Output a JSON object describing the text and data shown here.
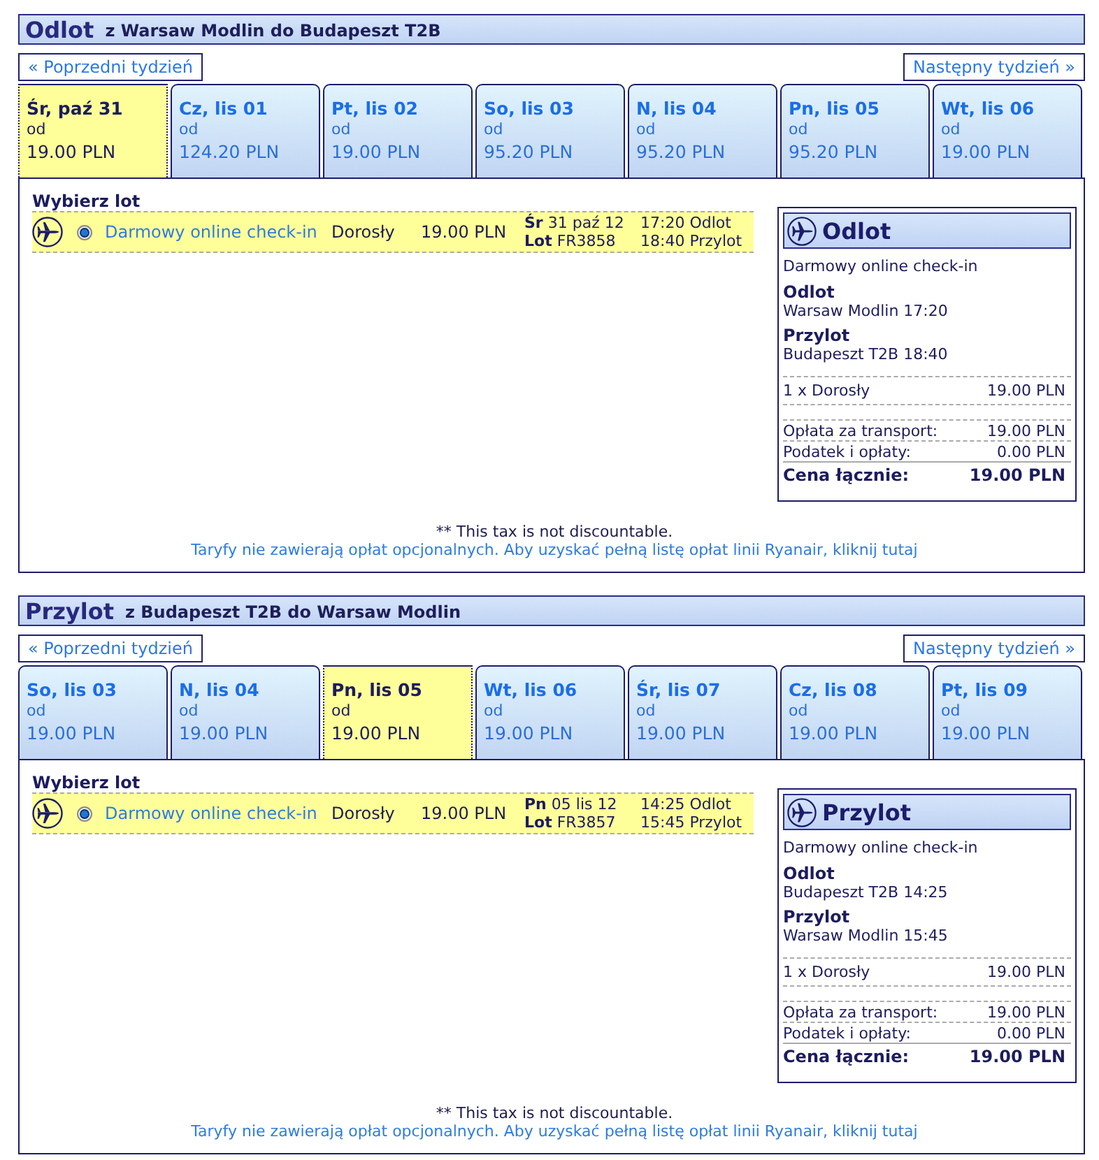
{
  "sections": [
    {
      "title": "Odlot",
      "route": "z Warsaw Modlin do Budapeszt T2B",
      "prev_week": "« Poprzedni tydzień",
      "next_week": "Następny tydzień »",
      "days": [
        {
          "label": "Śr, paź 31",
          "from_label": "od",
          "price": "19.00 PLN",
          "selected": true
        },
        {
          "label": "Cz, lis 01",
          "from_label": "od",
          "price": "124.20 PLN",
          "selected": false
        },
        {
          "label": "Pt, lis 02",
          "from_label": "od",
          "price": "19.00 PLN",
          "selected": false
        },
        {
          "label": "So, lis 03",
          "from_label": "od",
          "price": "95.20 PLN",
          "selected": false
        },
        {
          "label": "N, lis 04",
          "from_label": "od",
          "price": "95.20 PLN",
          "selected": false
        },
        {
          "label": "Pn, lis 05",
          "from_label": "od",
          "price": "95.20 PLN",
          "selected": false
        },
        {
          "label": "Wt, lis 06",
          "from_label": "od",
          "price": "19.00 PLN",
          "selected": false
        }
      ],
      "choose_label": "Wybierz lot",
      "flights": [
        {
          "selected": true,
          "fare": "Darmowy online check-in",
          "passenger": "Dorosły",
          "price": "19.00 PLN",
          "day": "Śr",
          "date": "31 paź 12",
          "flight_label": "Lot",
          "flight_no": "FR3858",
          "departure": "17:20 Odlot",
          "arrival": "18:40 Przylot"
        }
      ],
      "summary": {
        "title": "Odlot",
        "fare": "Darmowy online check-in",
        "stops": [
          {
            "label": "Odlot",
            "value": "Warsaw Modlin 17:20"
          },
          {
            "label": "Przylot",
            "value": "Budapeszt T2B 18:40"
          }
        ],
        "passengers": [
          {
            "label": "1 x Dorosły",
            "value": "19.00 PLN"
          }
        ],
        "fees": [
          {
            "label": "Opłata za transport:",
            "value": "19.00 PLN"
          },
          {
            "label": "Podatek i opłaty:",
            "value": "0.00 PLN"
          }
        ],
        "total": {
          "label": "Cena łącznie:",
          "value": "19.00 PLN"
        }
      },
      "tax_note": "** This tax is not discountable.",
      "fares_note": "Taryfy nie zawierają opłat opcjonalnych. Aby uzyskać pełną listę opłat linii Ryanair, kliknij tutaj"
    },
    {
      "title": "Przylot",
      "route": "z Budapeszt T2B do Warsaw Modlin",
      "prev_week": "« Poprzedni tydzień",
      "next_week": "Następny tydzień »",
      "days": [
        {
          "label": "So, lis 03",
          "from_label": "od",
          "price": "19.00 PLN",
          "selected": false
        },
        {
          "label": "N, lis 04",
          "from_label": "od",
          "price": "19.00 PLN",
          "selected": false
        },
        {
          "label": "Pn, lis 05",
          "from_label": "od",
          "price": "19.00 PLN",
          "selected": true
        },
        {
          "label": "Wt, lis 06",
          "from_label": "od",
          "price": "19.00 PLN",
          "selected": false
        },
        {
          "label": "Śr, lis 07",
          "from_label": "od",
          "price": "19.00 PLN",
          "selected": false
        },
        {
          "label": "Cz, lis 08",
          "from_label": "od",
          "price": "19.00 PLN",
          "selected": false
        },
        {
          "label": "Pt, lis 09",
          "from_label": "od",
          "price": "19.00 PLN",
          "selected": false
        }
      ],
      "choose_label": "Wybierz lot",
      "flights": [
        {
          "selected": true,
          "fare": "Darmowy online check-in",
          "passenger": "Dorosły",
          "price": "19.00 PLN",
          "day": "Pn",
          "date": "05 lis 12",
          "flight_label": "Lot",
          "flight_no": "FR3857",
          "departure": "14:25 Odlot",
          "arrival": "15:45 Przylot"
        }
      ],
      "summary": {
        "title": "Przylot",
        "fare": "Darmowy online check-in",
        "stops": [
          {
            "label": "Odlot",
            "value": "Budapeszt T2B 14:25"
          },
          {
            "label": "Przylot",
            "value": "Warsaw Modlin 15:45"
          }
        ],
        "passengers": [
          {
            "label": "1 x Dorosły",
            "value": "19.00 PLN"
          }
        ],
        "fees": [
          {
            "label": "Opłata za transport:",
            "value": "19.00 PLN"
          },
          {
            "label": "Podatek i opłaty:",
            "value": "0.00 PLN"
          }
        ],
        "total": {
          "label": "Cena łącznie:",
          "value": "19.00 PLN"
        }
      },
      "tax_note": "** This tax is not discountable.",
      "fares_note": "Taryfy nie zawierają opłat opcjonalnych. Aby uzyskać pełną listę opłat linii Ryanair, kliknij tutaj"
    }
  ]
}
